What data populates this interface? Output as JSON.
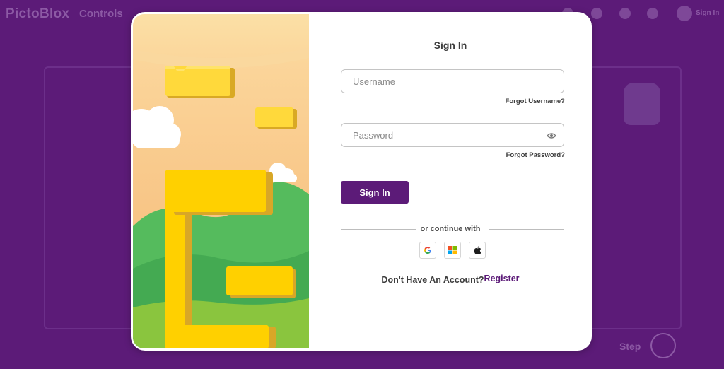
{
  "background": {
    "logo": "PictoBlox",
    "menu": "Controls",
    "account": "Sign In",
    "step": "Step"
  },
  "modal": {
    "title": "Sign In",
    "username": {
      "placeholder": "Username"
    },
    "forgot_username": "Forgot Username?",
    "password": {
      "placeholder": "Password"
    },
    "forgot_password": "Forgot Password?",
    "signin_button": "Sign In",
    "divider": "or continue with",
    "social": [
      "google-icon",
      "microsoft-icon",
      "apple-icon"
    ],
    "no_account": "Don't Have An Account?",
    "register": "Register"
  },
  "colors": {
    "brand": "#5c1b78",
    "block": "#ffd000"
  }
}
